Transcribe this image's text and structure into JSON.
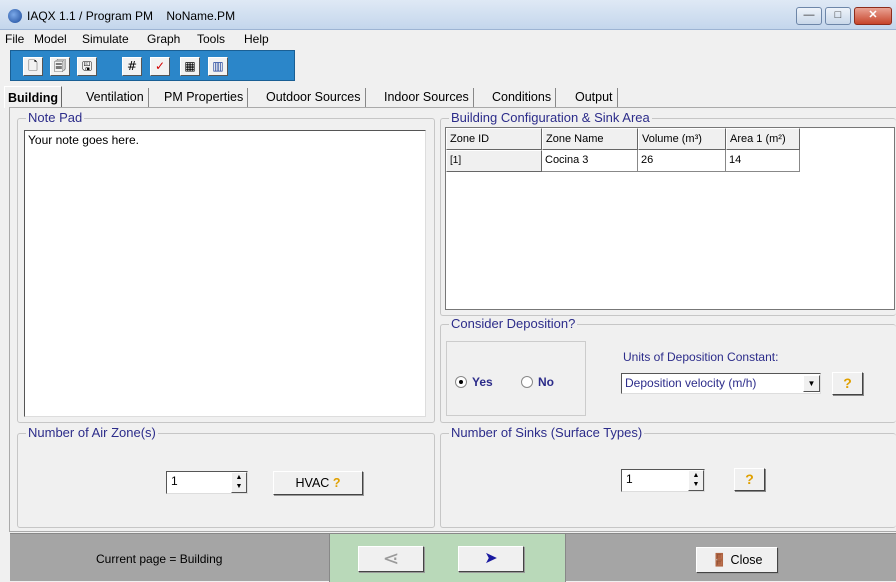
{
  "window": {
    "title": "IAQX 1.1 / Program PM    NoName.PM",
    "minimize_glyph": "—",
    "maximize_glyph": "□",
    "close_glyph": "✕"
  },
  "menu": [
    "File",
    "Model",
    "Simulate",
    "Graph",
    "Tools",
    "Help"
  ],
  "toolbar": {
    "icons": [
      "new-file-icon",
      "open-file-icon",
      "save-file-icon",
      "run-icon",
      "check-icon",
      "calculator-icon",
      "chart-icon"
    ],
    "glyphs": [
      "🗋",
      "🗐",
      "🖫",
      "#",
      "✓",
      "▦",
      "▥"
    ],
    "colors": {
      "background": "#2b86c9",
      "check": "#d40000"
    }
  },
  "tabs": [
    "Building",
    "Ventilation",
    "PM Properties",
    "Outdoor Sources",
    "Indoor Sources",
    "Conditions",
    "Output"
  ],
  "active_tab": "Building",
  "note_pad": {
    "title": "Note Pad",
    "text": "Your note goes here."
  },
  "building_config": {
    "title": "Building Configuration & Sink Area",
    "columns": [
      "Zone ID",
      "Zone Name",
      "Volume (m³)",
      "Area 1 (m²)"
    ],
    "rows": [
      [
        "[1]",
        "Cocina 3",
        "26",
        "14"
      ]
    ]
  },
  "deposition": {
    "title": "Consider Deposition?",
    "yes_label": "Yes",
    "no_label": "No",
    "selected": "Yes",
    "units_label": "Units of Deposition Constant:",
    "units_value": "Deposition velocity (m/h)",
    "help_glyph": "?"
  },
  "air_zones": {
    "title": "Number of Air Zone(s)",
    "value": "1",
    "hvac_label": "HVAC",
    "help_glyph": "?"
  },
  "sinks": {
    "title": "Number of Sinks (Surface Types)",
    "value": "1",
    "help_glyph": "?"
  },
  "status": {
    "current_page": "Current page = Building",
    "prev_glyph": "⋖",
    "next_glyph": "➤",
    "close_label": "Close",
    "colors": {
      "bar": "#a5a5a5",
      "nav": "#b9d9b9",
      "next_arrow": "#1a1aa0"
    }
  }
}
